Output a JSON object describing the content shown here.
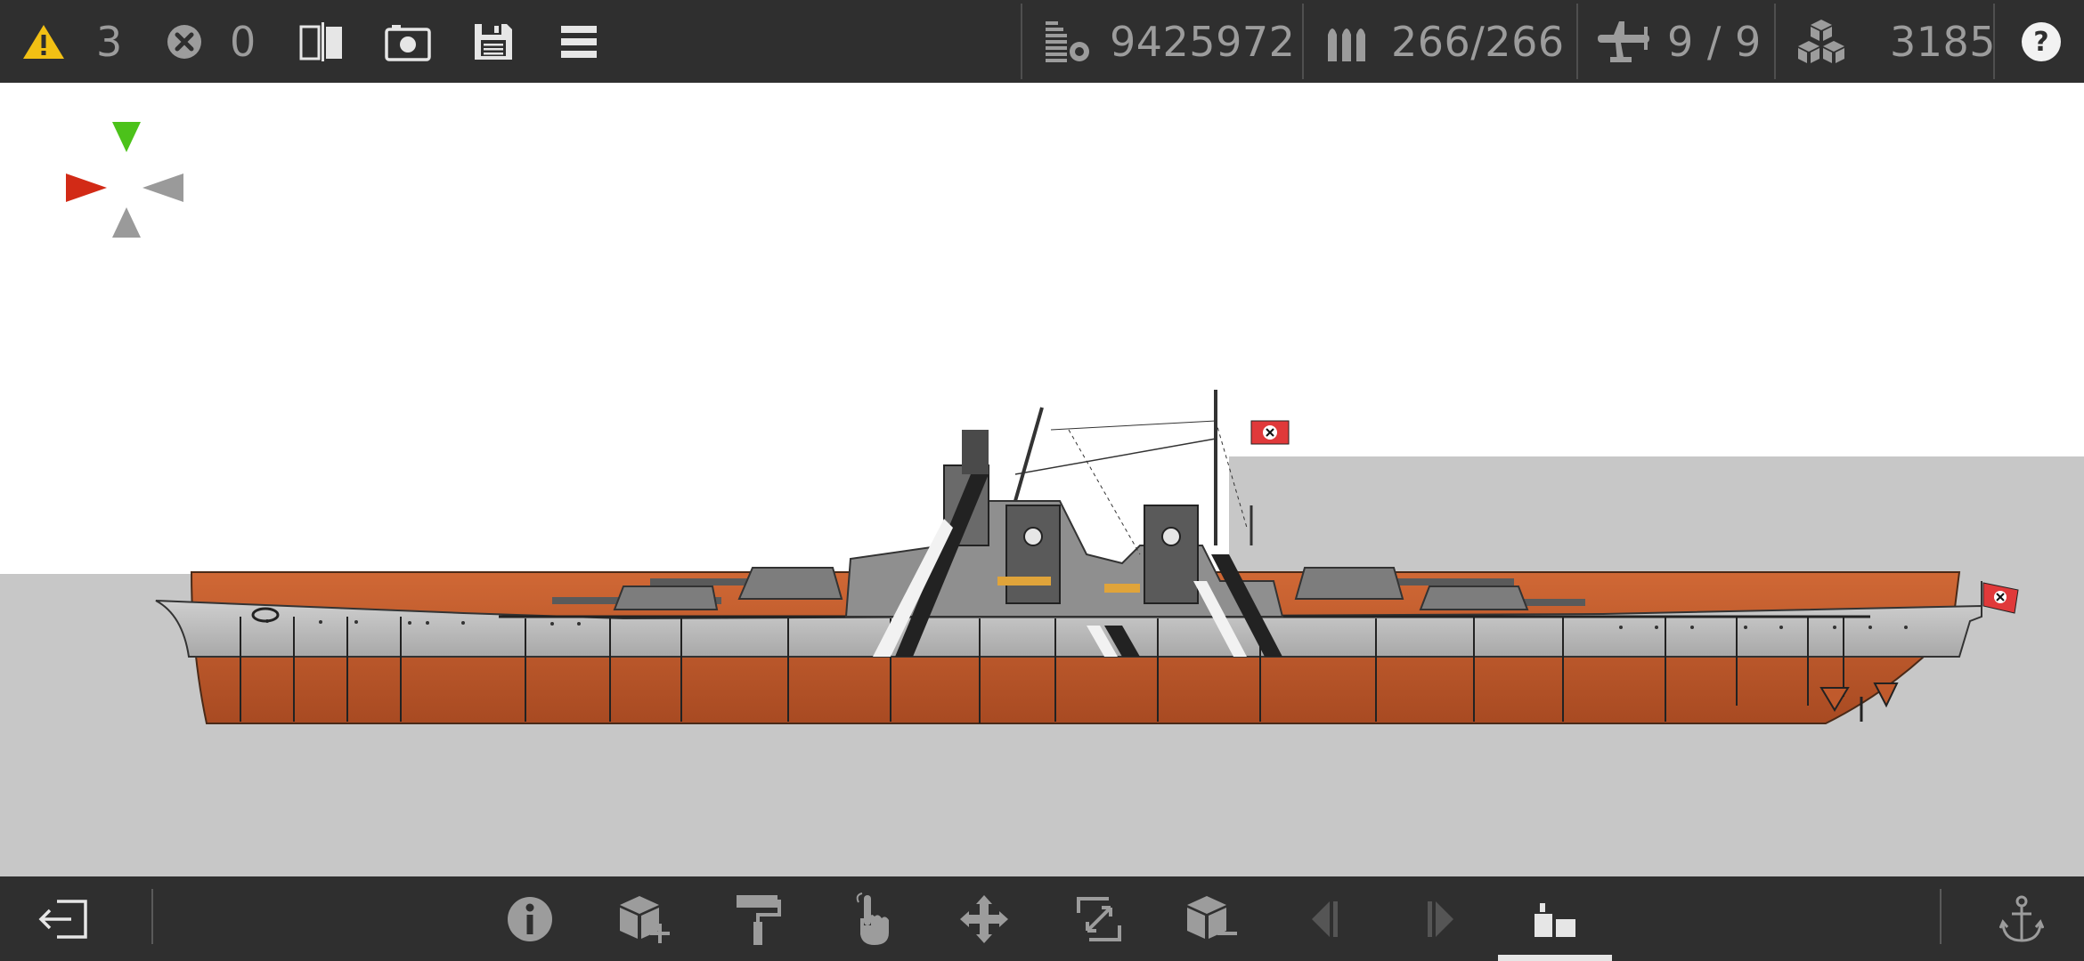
{
  "status_bar": {
    "warnings": {
      "icon": "warning-icon",
      "count": "3",
      "color": "#f2c014"
    },
    "errors": {
      "icon": "error-icon",
      "count": "0"
    },
    "cost": {
      "icon": "cost-icon",
      "value": "9425972"
    },
    "ammo": {
      "icon": "ammo-icon",
      "value": "266/266"
    },
    "aircraft": {
      "icon": "airplane-icon",
      "value": "9 / 9"
    },
    "parts": {
      "icon": "parts-icon",
      "value": "3185"
    }
  },
  "toolbar_top": [
    {
      "name": "split-view-button",
      "icon": "split-view-icon"
    },
    {
      "name": "screenshot-button",
      "icon": "camera-icon"
    },
    {
      "name": "save-button",
      "icon": "floppy-disk-icon"
    },
    {
      "name": "menu-button",
      "icon": "hamburger-menu-icon"
    },
    {
      "name": "help-button",
      "icon": "help-icon"
    }
  ],
  "orientation_gizmo": {
    "up_color": "#4cc21a",
    "left_color": "#d22a16",
    "inactive_color": "#9a9a9a"
  },
  "ship": {
    "hull_color": "#c05a2c",
    "deck_color": "#b5b5b5",
    "flag_color": "#e0393a"
  },
  "toolbar_bottom": [
    {
      "name": "exit-button",
      "icon": "exit-icon"
    },
    {
      "name": "info-button",
      "icon": "info-icon"
    },
    {
      "name": "add-part-button",
      "icon": "add-part-icon"
    },
    {
      "name": "paint-button",
      "icon": "paint-roller-icon"
    },
    {
      "name": "select-button",
      "icon": "hand-pointer-icon"
    },
    {
      "name": "move-button",
      "icon": "move-arrows-icon"
    },
    {
      "name": "resize-button",
      "icon": "resize-icon"
    },
    {
      "name": "remove-part-button",
      "icon": "remove-part-icon"
    },
    {
      "name": "previous-button",
      "icon": "previous-icon"
    },
    {
      "name": "next-button",
      "icon": "next-icon"
    },
    {
      "name": "view-mode-button",
      "icon": "view-mode-icon"
    },
    {
      "name": "anchor-button",
      "icon": "anchor-icon"
    }
  ]
}
